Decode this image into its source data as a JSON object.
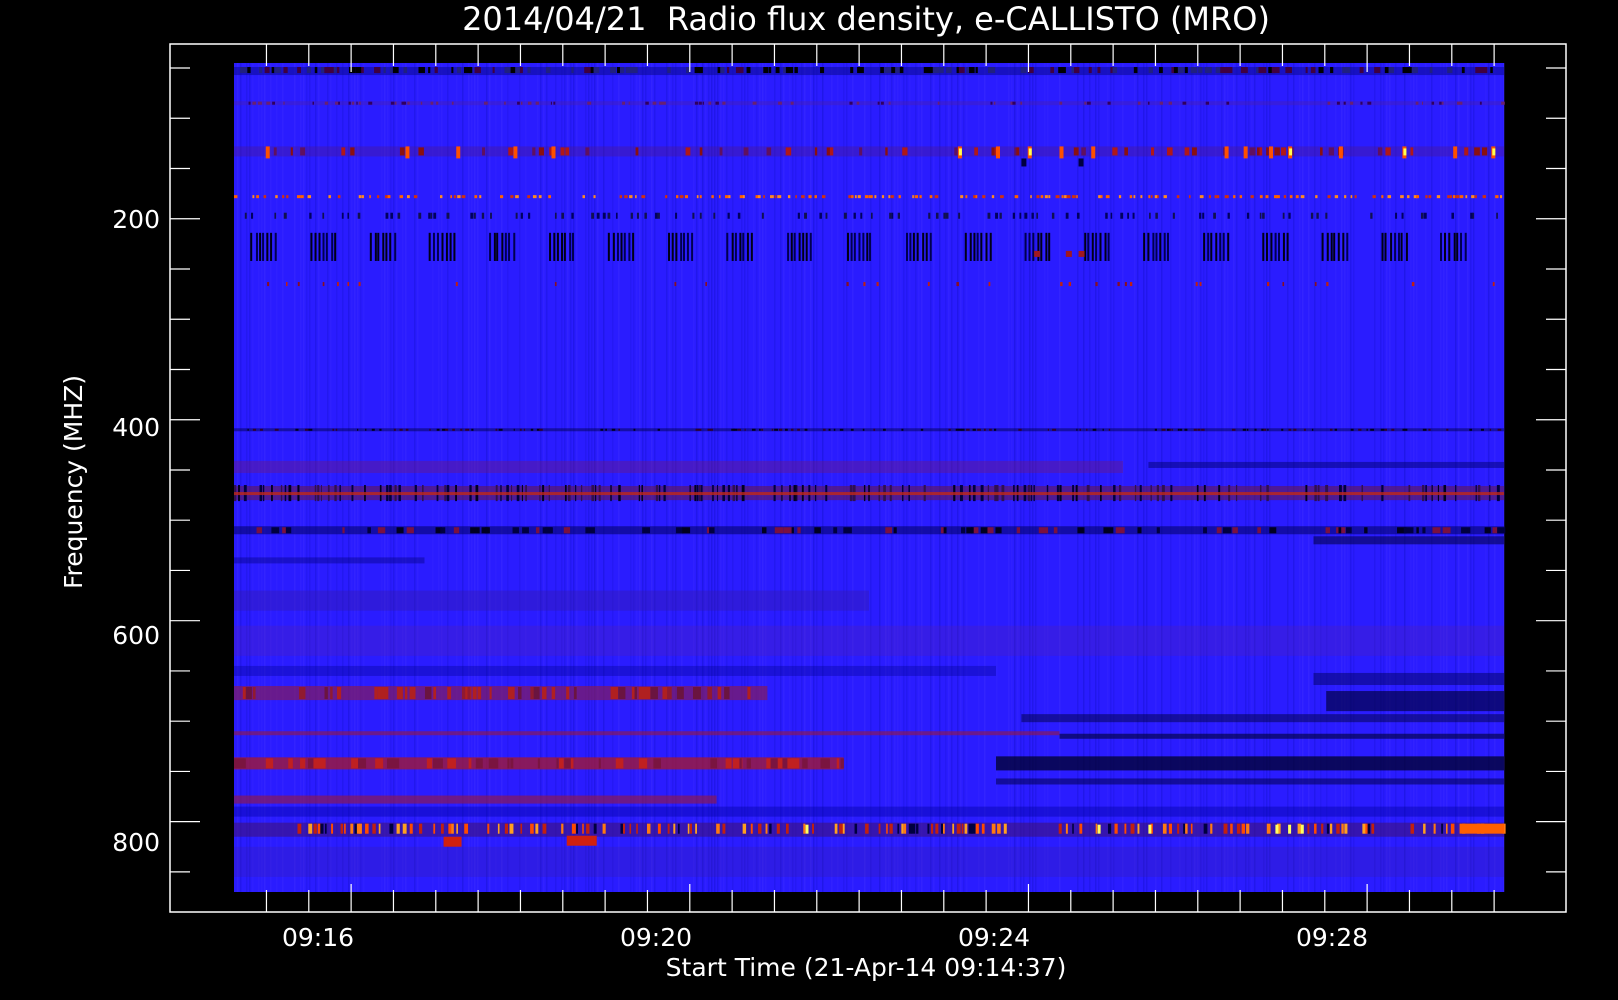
{
  "chart_data": {
    "type": "heatmap",
    "title": "2014/04/21  Radio flux density, e-CALLISTO (MRO)",
    "xlabel": "Start Time (21-Apr-14 09:14:37)",
    "ylabel": "Frequency (MHZ)",
    "x_range": [
      "09:14:37",
      "09:29:37"
    ],
    "y_range_mhz": [
      45,
      870
    ],
    "y_inverted": true,
    "x_ticks": [
      {
        "label": "09:16",
        "value": "09:16"
      },
      {
        "label": "09:20",
        "value": "09:20"
      },
      {
        "label": "09:24",
        "value": "09:24"
      },
      {
        "label": "09:28",
        "value": "09:28"
      }
    ],
    "y_ticks": [
      {
        "label": "200",
        "value": 200
      },
      {
        "label": "400",
        "value": 400
      },
      {
        "label": "600",
        "value": 600
      },
      {
        "label": "800",
        "value": 800
      }
    ],
    "colormap": [
      "#000000",
      "#0000c8",
      "#2a1cff",
      "#b01010",
      "#ff4000",
      "#ffff40"
    ],
    "background_color": "#2a1cff",
    "features": [
      {
        "freq_mhz": 55,
        "description": "dark speckle band at top"
      },
      {
        "freq_mhz": 133,
        "description": "intermittent bright red/yellow bursts"
      },
      {
        "freq_mhz": 178,
        "description": "dotted orange RFI line"
      },
      {
        "freq_mhz": 228,
        "description": "periodic dark vertical blocks"
      },
      {
        "freq_mhz": 473,
        "description": "red/dark striped RFI band"
      },
      {
        "freq_mhz": 510,
        "description": "dark band"
      },
      {
        "freq_mhz": 672,
        "description": "reddish band, left side"
      },
      {
        "freq_mhz": 742,
        "description": "red band left, dark band right"
      },
      {
        "freq_mhz": 808,
        "description": "bright orange/yellow burst line"
      }
    ]
  }
}
